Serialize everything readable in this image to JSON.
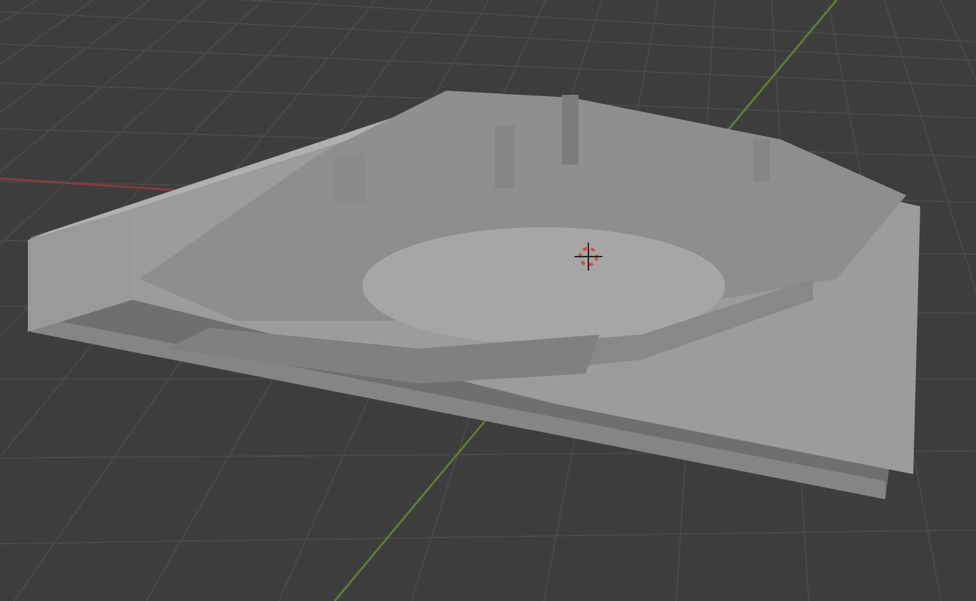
{
  "viewport": {
    "grid": true,
    "x_axis": true,
    "y_axis": true,
    "cursor": true,
    "model": true
  }
}
